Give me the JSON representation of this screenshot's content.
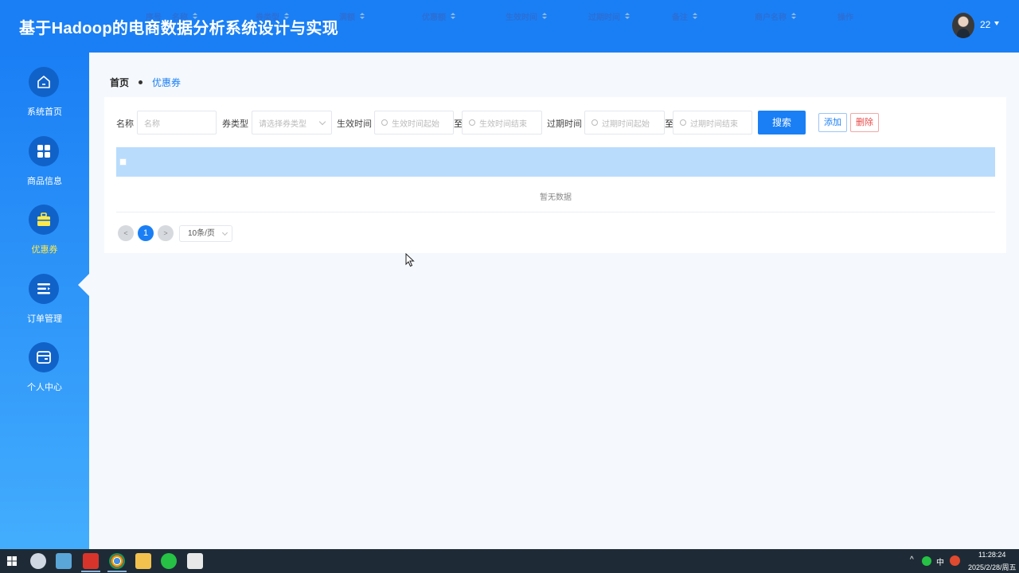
{
  "header": {
    "title": "基于Hadoop的电商数据分析系统设计与实现",
    "user": "22"
  },
  "sidebar": {
    "items": [
      {
        "label": "系统首页",
        "icon": "home-icon"
      },
      {
        "label": "商品信息",
        "icon": "grid-icon"
      },
      {
        "label": "优惠券",
        "icon": "briefcase-icon",
        "active": true
      },
      {
        "label": "订单管理",
        "icon": "list-icon"
      },
      {
        "label": "个人中心",
        "icon": "wallet-icon"
      }
    ]
  },
  "breadcrumb": {
    "home": "首页",
    "current": "优惠券"
  },
  "search": {
    "name_label": "名称",
    "name_placeholder": "名称",
    "type_label": "券类型",
    "type_placeholder": "请选择券类型",
    "effective_label": "生效时间",
    "effective_start_placeholder": "生效时间起始",
    "effective_end_placeholder": "生效时间结束",
    "expire_label": "过期时间",
    "expire_start_placeholder": "过期时间起始",
    "expire_end_placeholder": "过期时间结束",
    "range_sep": "至",
    "search_button": "搜索",
    "add_button": "添加",
    "delete_button": "删除"
  },
  "table": {
    "columns": [
      "序号",
      "名称",
      "券类型",
      "满额",
      "优惠额",
      "生效时间",
      "过期时间",
      "备注",
      "商户名称",
      "操作"
    ],
    "empty_text": "暂无数据"
  },
  "pagination": {
    "prev": "<",
    "current": "1",
    "next": ">",
    "page_size": "10条/页"
  },
  "taskbar": {
    "tray_lang": "中",
    "time": "11:28:24",
    "date": "2025/2/28/周五"
  },
  "colors": {
    "primary": "#1a7ff5",
    "active_nav": "#ffe94a",
    "danger": "#e84a4a"
  }
}
